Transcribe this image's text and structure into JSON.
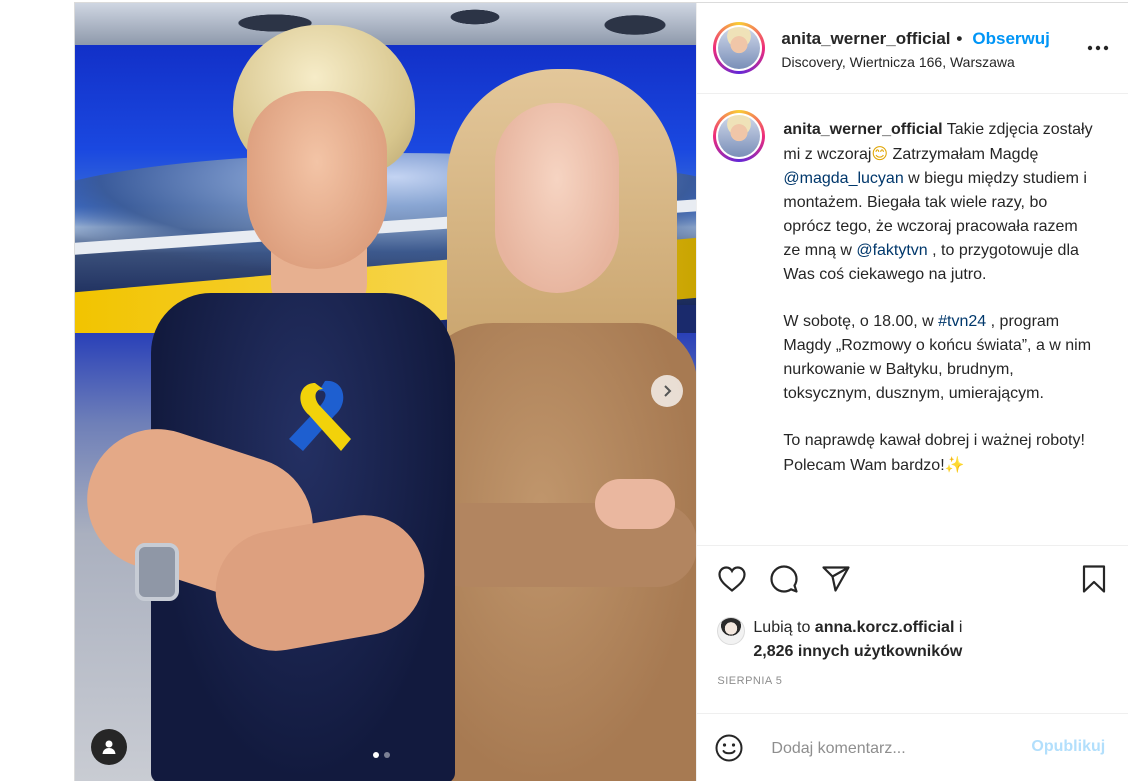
{
  "post": {
    "author": {
      "username": "anita_werner_official",
      "separator": "•",
      "follow_label": "Obserwuj",
      "location": "Discovery, Wiertnicza 166, Warszawa"
    },
    "more_icon": "more-horizontal-icon",
    "caption": {
      "username": "anita_werner_official",
      "paragraphs": [
        {
          "parts": [
            {
              "type": "text",
              "value": " Takie zdjęcia zostały mi z wczoraj"
            },
            {
              "type": "emoji",
              "value": "😊"
            },
            {
              "type": "text",
              "value": " Zatrzymałam Magdę "
            },
            {
              "type": "mention",
              "value": "@magda_lucyan"
            },
            {
              "type": "text",
              "value": " w biegu między studiem i montażem. Biegała tak wiele razy, bo oprócz tego, że wczoraj pracowała razem ze mną w "
            },
            {
              "type": "mention",
              "value": "@faktytvn"
            },
            {
              "type": "text",
              "value": " , to przygotowuje dla Was coś ciekawego na jutro."
            }
          ]
        },
        {
          "parts": [
            {
              "type": "text",
              "value": "W sobotę, o 18.00, w "
            },
            {
              "type": "mention",
              "value": "#tvn24"
            },
            {
              "type": "text",
              "value": " , program Magdy „Rozmowy o końcu świata”, a w nim nurkowanie w Bałtyku, brudnym, toksycznym, dusznym, umierającym."
            }
          ]
        },
        {
          "parts": [
            {
              "type": "text",
              "value": "To naprawdę kawał dobrej i ważnej roboty! Polecam Wam bardzo!"
            },
            {
              "type": "emoji",
              "value": "✨"
            }
          ]
        }
      ]
    },
    "actions": {
      "like_icon": "heart-icon",
      "comment_icon": "comment-icon",
      "share_icon": "send-icon",
      "save_icon": "bookmark-icon"
    },
    "likes": {
      "prefix": "Lubią to ",
      "liker": "anna.korcz.official",
      "joiner": " i",
      "others": "2,826 innych użytkowników"
    },
    "date": "SIERPNIA 5",
    "comment": {
      "emoji_icon": "smiley-icon",
      "placeholder": "Dodaj komentarz...",
      "publish_label": "Opublikuj"
    },
    "media": {
      "next_icon": "chevron-right-icon",
      "tag_icon": "user-tag-icon",
      "carousel": {
        "count": 2,
        "active": 1
      }
    },
    "colors": {
      "accent": "#0095f6",
      "mention": "#00376b",
      "publish_disabled": "#b2dffc",
      "muted": "#8e8e8e"
    }
  }
}
